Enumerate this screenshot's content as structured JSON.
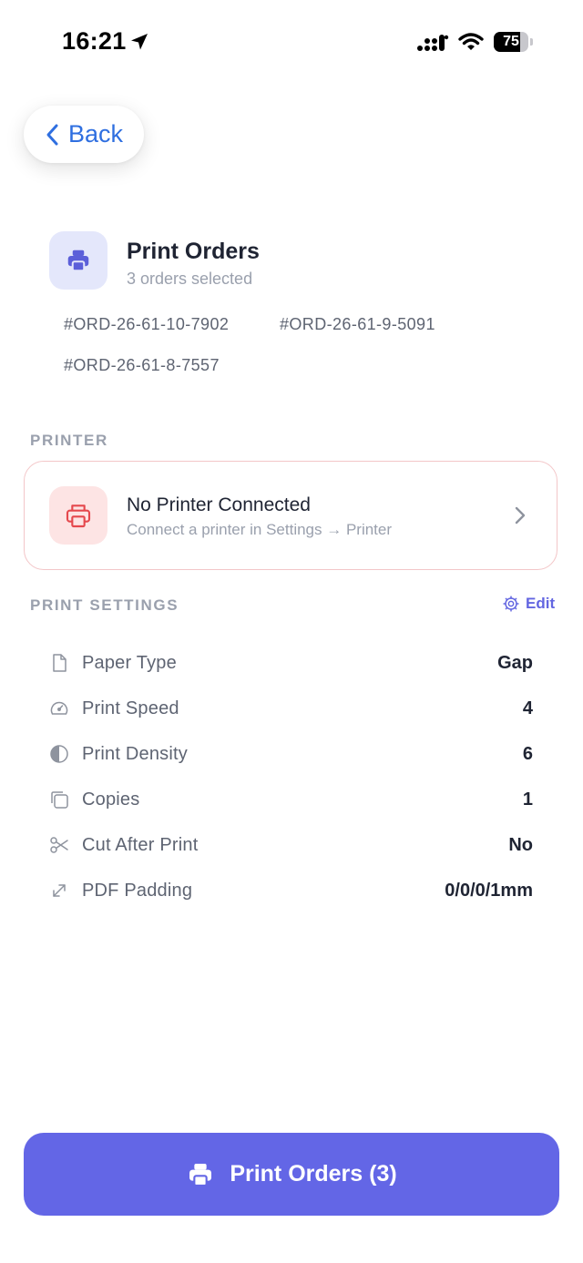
{
  "status_bar": {
    "time": "16:21",
    "battery_level": "75",
    "battery_fraction": 0.75
  },
  "nav": {
    "back_label": "Back"
  },
  "header": {
    "title": "Print Orders",
    "subtitle": "3 orders selected",
    "icon": "printer-icon",
    "orders": [
      "#ORD-26-61-10-7902",
      "#ORD-26-61-9-5091",
      "#ORD-26-61-8-7557"
    ]
  },
  "printer_section": {
    "label": "PRINTER",
    "card": {
      "title": "No Printer Connected",
      "subtitle": "Connect a printer in Settings → Printer",
      "icon": "printer-icon",
      "status_color": "#e5484d"
    }
  },
  "settings_section": {
    "label": "PRINT SETTINGS",
    "edit_label": "Edit",
    "rows": [
      {
        "icon": "file-icon",
        "name": "Paper Type",
        "value": "Gap"
      },
      {
        "icon": "gauge-icon",
        "name": "Print Speed",
        "value": "4"
      },
      {
        "icon": "contrast-icon",
        "name": "Print Density",
        "value": "6"
      },
      {
        "icon": "copy-icon",
        "name": "Copies",
        "value": "1"
      },
      {
        "icon": "scissors-icon",
        "name": "Cut After Print",
        "value": "No"
      },
      {
        "icon": "expand-icon",
        "name": "PDF Padding",
        "value": "0/0/0/1mm"
      }
    ]
  },
  "primary_action": {
    "label": "Print Orders (3)",
    "icon": "printer-icon",
    "color": "#6366e6"
  }
}
